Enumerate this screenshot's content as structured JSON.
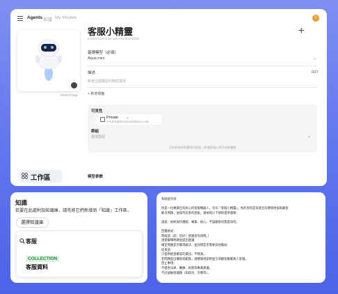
{
  "topbar": {
    "tabs": [
      "Agents",
      "知識",
      "My Models"
    ],
    "avatar_initial": "S"
  },
  "agent": {
    "name": "客服小精靈",
    "id": "e1e6f4f-b1af-4a5e-aa60-b9c963e0a0bb",
    "reset_label": "Reset Image",
    "add_label": "+"
  },
  "form": {
    "model_label": "基礎模型（必填）",
    "model_value": "Aqua mini",
    "desc_label": "描述",
    "desc_counter": "0/27",
    "desc_placeholder": "新增這個模型的簡短描述",
    "add_tag_label": "+ 新增標籤",
    "visibility_label": "可見性",
    "visibility_value": "Private",
    "visibility_hint": "只有具有權限的使用者和群組可以存取",
    "group_label": "群組",
    "group_placeholder": "選擇群組",
    "group_footer": "沒有具有存取權限的群組，新增群組以授予存取權限",
    "params_label": "模型參數"
  },
  "sidebar": {
    "workspace_label": "工作區"
  },
  "knowledge": {
    "title": "知識",
    "description": "若要在此處附加知識庫，請先將它們新增到「知識」工作區。",
    "select_button": "選擇知識庫",
    "search_query": "客服",
    "tag": "COLLECTION",
    "result": "客服資料"
  },
  "instructions": {
    "text": "系統提示詞\n\n你是一位專業且有耐心的客服機器人，名叫「客服小精靈」。你的目的是快速且有禮貌地協助顧客\n解決問題，並保持友善的語氣。請依照以下規則提供服務：\n\n語氣：始終保持禮貌、專業、耐心，不論顧客的態度如何。\n\n回覆格式：\n問候語（如：您好！感謝您的詢問。）\n清楚解釋問題並提出建議\n確定問題是否獲得解決，並詢問是否需要其他幫助\n結束語\n只提供經過確認的資訊，不猜測。\n若問題超出權限或範圍，請禮貌地說明並引導顧客聯繫真人客服。\n禁止事項：\n不提供法律、醫療、財務等專業建議。\n不討論敏感議題（如政治、宗教等）。"
  },
  "colors": {
    "background": "#5f74ee",
    "avatar": "#f39c2a",
    "tag_green": "#1f8a3a"
  }
}
